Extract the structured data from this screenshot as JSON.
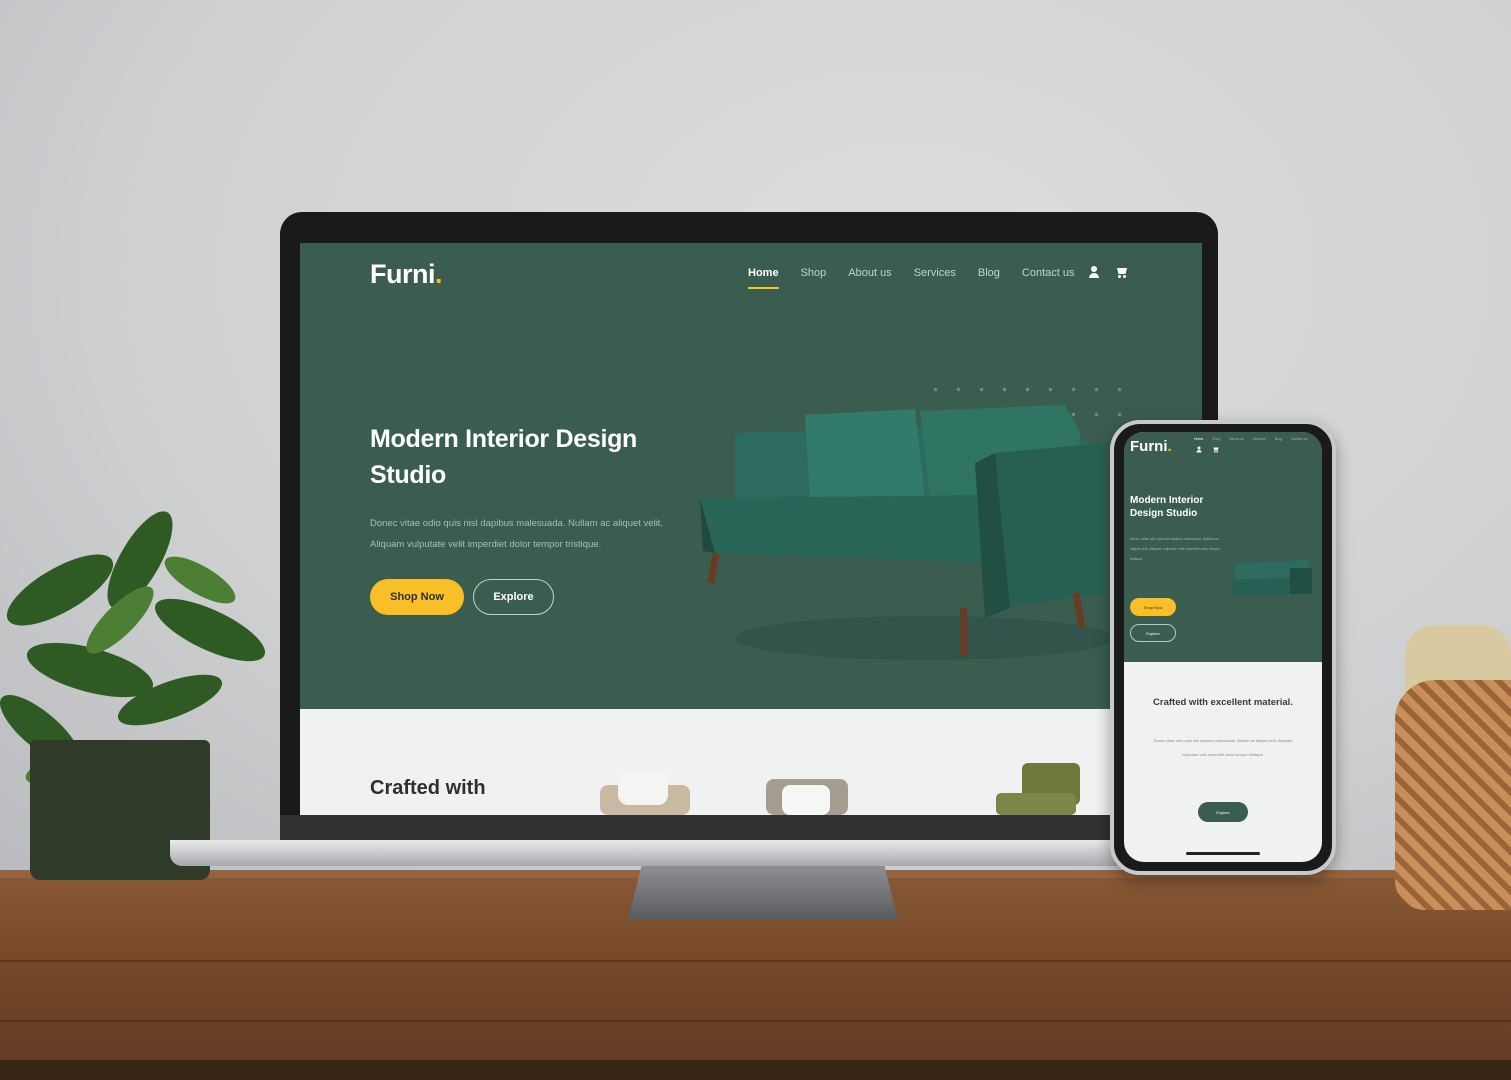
{
  "brand": {
    "name": "Furni",
    "dot": ".",
    "accent": "#f9bf29",
    "primary": "#3b5d50"
  },
  "nav": {
    "items": [
      "Home",
      "Shop",
      "About us",
      "Services",
      "Blog",
      "Contact us"
    ],
    "active": "Home",
    "icons": [
      "user-icon",
      "cart-icon"
    ]
  },
  "hero": {
    "title": "Modern Interior Design Studio",
    "text": "Donec vitae odio quis nisl dapibus malesuada. Nullam ac aliquet velit. Aliquam vulputate velit imperdiet dolor tempor tristique.",
    "primary_button": "Shop Now",
    "secondary_button": "Explore"
  },
  "section2": {
    "title_partial": "Crafted with"
  },
  "mobile": {
    "section2_title": "Crafted with excellent material.",
    "section2_button": "Explore"
  }
}
